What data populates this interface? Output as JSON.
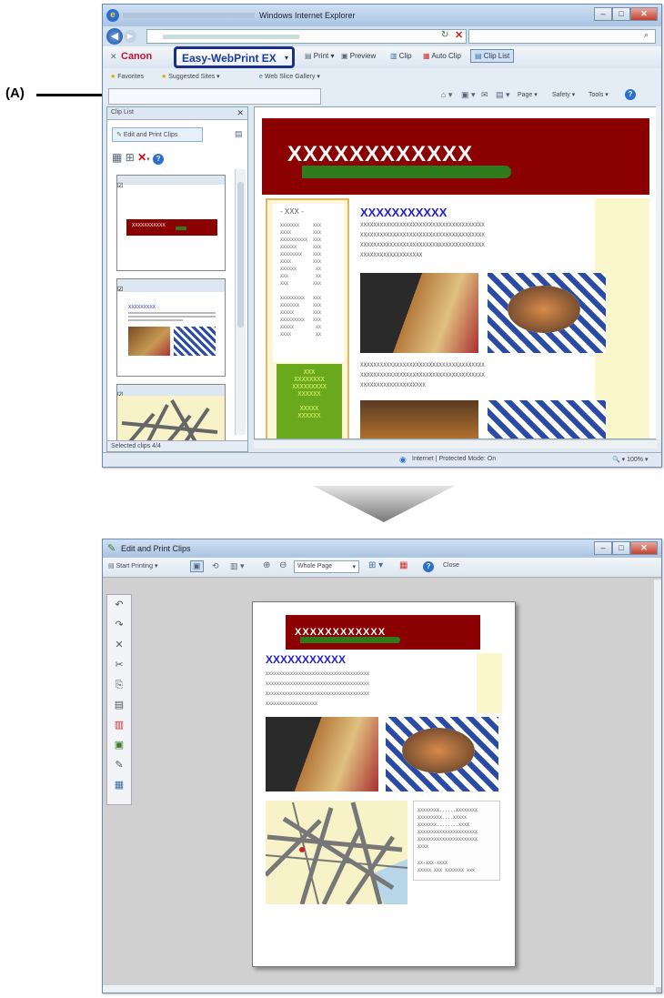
{
  "callout": {
    "label": "(A)"
  },
  "browser": {
    "title": "Windows Internet Explorer",
    "tb": {
      "canon": "Canon",
      "ewp": "Easy-WebPrint EX",
      "print": "Print",
      "preview": "Preview",
      "clip": "Clip",
      "auto_clip": "Auto Clip",
      "clip_list": "Clip List"
    },
    "fav": {
      "favorites": "Favorites",
      "suggested": "Suggested Sites",
      "gallery": "Web Slice Gallery"
    },
    "cmd": {
      "page": "Page",
      "safety": "Safety",
      "tools": "Tools"
    },
    "panel": {
      "title": "Clip List",
      "edit_print": "Edit and Print Clips",
      "thumb1": "XXXXXXXXXXX",
      "thumb2": "XXXXXXXXX",
      "status": "Selected clips 4/4"
    },
    "page": {
      "banner": "XXXXXXXXXXXX",
      "side_title": "- XXX -",
      "side_rows1": "XXXXXXX     XXX\nXXXX        XXX\nXXXXXXXXXX  XXX\nXXXXXX      XXX\nXXXXXXXX    XXX\nXXXX        XXX\nXXXXXX       XX\nXXX          XX\nXXX         XXX",
      "side_rows2": "XXXXXXXXX   XXX\nXXXXXXX     XXX\nXXXXX       XXX\nXXXXXXXXX   XXX\nXXXXX        XX\nXXXX         XX",
      "green_box": "XXX\nXXXXXXXX\nXXXXXXXXX\nXXXXXX\n\nXXXXX\nXXXXXX",
      "heading": "XXXXXXXXXXX",
      "para1": "XXXXXXXXXXXXXXXXXXXXXXXXXXXXXXXXXXXXXX\nXXXXXXXXXXXXXXXXXXXXXXXXXXXXXXXXXXXXXX\nXXXXXXXXXXXXXXXXXXXXXXXXXXXXXXXXXXXXXX\nXXXXXXXXXXXXXXXXXXX",
      "para2": "XXXXXXXXXXXXXXXXXXXXXXXXXXXXXXXXXXXXXX\nXXXXXXXXXXXXXXXXXXXXXXXXXXXXXXXXXXXXXX\nXXXXXXXXXXXXXXXXXXXX"
    },
    "status": {
      "zone": "Internet | Protected Mode: On",
      "zoom": "100%"
    }
  },
  "editor": {
    "title": "Edit and Print Clips",
    "start_printing": "Start Printing",
    "zoom_select": "Whole Page",
    "close": "Close",
    "doc": {
      "banner": "XXXXXXXXXXXX",
      "heading": "XXXXXXXXXXX",
      "para": "XXXXXXXXXXXXXXXXXXXXXXXXXXXXXXXXXXXXXX\nXXXXXXXXXXXXXXXXXXXXXXXXXXXXXXXXXXXXXX\nXXXXXXXXXXXXXXXXXXXXXXXXXXXXXXXXXXXXXX\nXXXXXXXXXXXXXXXXXXX",
      "info1": "XXXXXXXX......XXXXXXXX\nXXXXXXXXX....XXXXX\nXXXXXXX........XXXX\nXXXXXXXXXXXXXXXXXXXXXX\nXXXXXXXXXXXXXXXXXXXXXX\nXXXX",
      "info2": "XX-XXX-XXXX\nXXXXX XXX XXXXXXX xxx"
    }
  },
  "colors": {
    "ewp_blue": "#1a3a9c",
    "banner_red": "#8b0000",
    "heading_blue": "#2222cc",
    "green_box": "#6aa81e"
  }
}
